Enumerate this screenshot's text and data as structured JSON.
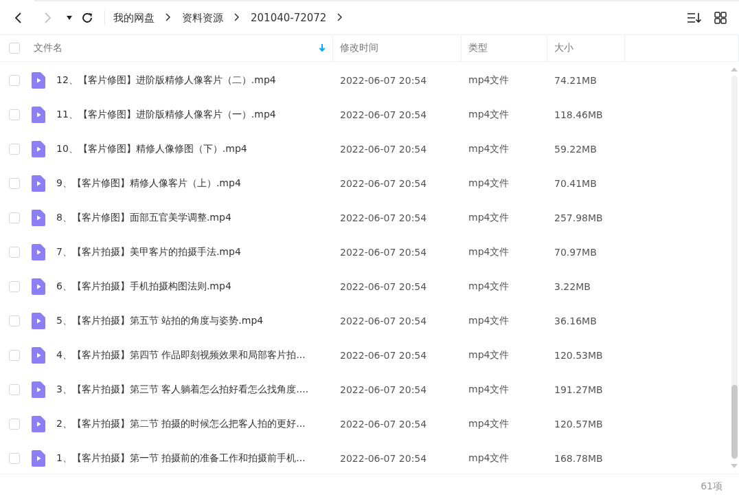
{
  "breadcrumb": [
    "我的网盘",
    "资料资源",
    "201040-72072"
  ],
  "table": {
    "columns": [
      {
        "label": "文件名",
        "sorted": true
      },
      {
        "label": "修改时间",
        "sorted": false
      },
      {
        "label": "类型",
        "sorted": false
      },
      {
        "label": "大小",
        "sorted": false
      }
    ],
    "all_checked": false,
    "rows": [
      {
        "name": "12、【客片修图】进阶版精修人像客片（二）.mp4",
        "modified": "2022-06-07 20:54",
        "type": "mp4文件",
        "size": "74.21MB",
        "checked": false
      },
      {
        "name": "11、【客片修图】进阶版精修人像客片（一）.mp4",
        "modified": "2022-06-07 20:54",
        "type": "mp4文件",
        "size": "118.46MB",
        "checked": false
      },
      {
        "name": "10、【客片修图】精修人像修图（下）.mp4",
        "modified": "2022-06-07 20:54",
        "type": "mp4文件",
        "size": "59.22MB",
        "checked": false
      },
      {
        "name": "9、【客片修图】精修人像客片（上）.mp4",
        "modified": "2022-06-07 20:54",
        "type": "mp4文件",
        "size": "70.41MB",
        "checked": false
      },
      {
        "name": "8、【客片修图】面部五官美学调整.mp4",
        "modified": "2022-06-07 20:54",
        "type": "mp4文件",
        "size": "257.98MB",
        "checked": false
      },
      {
        "name": "7、【客片拍摄】美甲客片的拍摄手法.mp4",
        "modified": "2022-06-07 20:54",
        "type": "mp4文件",
        "size": "70.97MB",
        "checked": false
      },
      {
        "name": "6、【客片拍摄】手机拍摄构图法则.mp4",
        "modified": "2022-06-07 20:54",
        "type": "mp4文件",
        "size": "3.22MB",
        "checked": false
      },
      {
        "name": "5、【客片拍摄】第五节 站拍的角度与姿势.mp4",
        "modified": "2022-06-07 20:54",
        "type": "mp4文件",
        "size": "36.16MB",
        "checked": false
      },
      {
        "name": "4、【客片拍摄】第四节 作品即刻视频效果和局部客片拍...",
        "modified": "2022-06-07 20:54",
        "type": "mp4文件",
        "size": "120.53MB",
        "checked": false
      },
      {
        "name": "3、【客片拍摄】第三节 客人躺着怎么拍好看怎么找角度....",
        "modified": "2022-06-07 20:54",
        "type": "mp4文件",
        "size": "191.27MB",
        "checked": false
      },
      {
        "name": "2、【客片拍摄】第二节 拍摄的时候怎么把客人拍的更好...",
        "modified": "2022-06-07 20:54",
        "type": "mp4文件",
        "size": "120.57MB",
        "checked": false
      },
      {
        "name": "1、【客片拍摄】第一节 拍摄前的准备工作和拍摄前手机...",
        "modified": "2022-06-07 20:54",
        "type": "mp4文件",
        "size": "168.78MB",
        "checked": false
      }
    ]
  },
  "status_bar": {
    "count": "61项"
  }
}
